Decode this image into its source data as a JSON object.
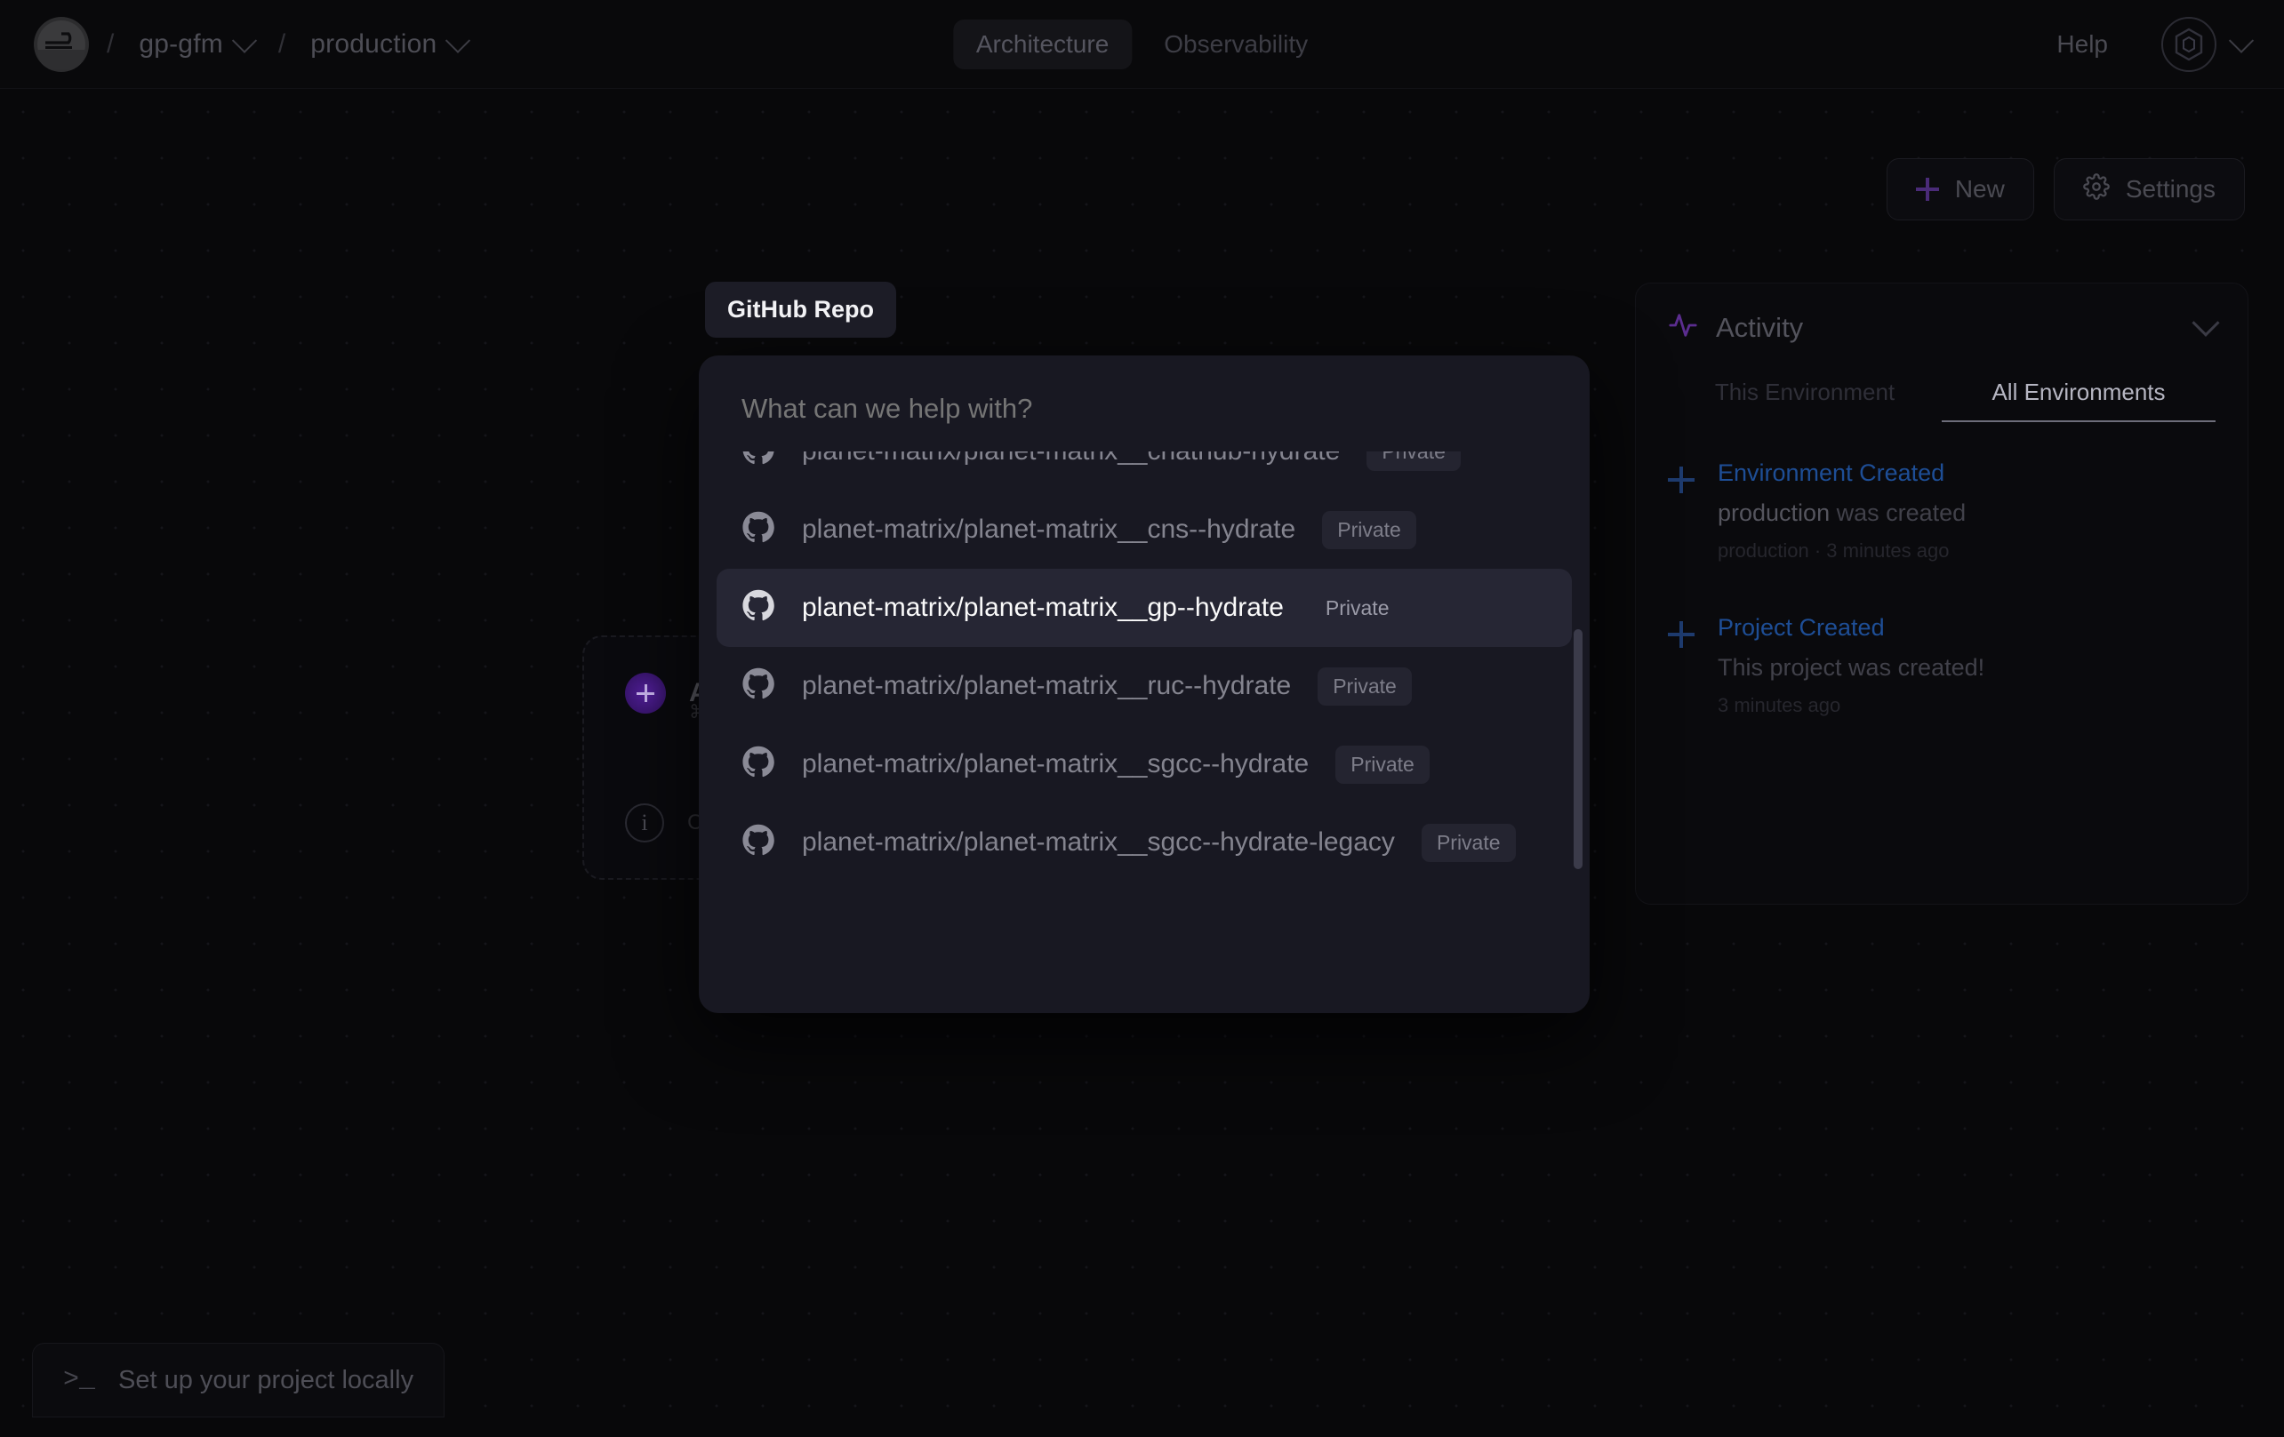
{
  "header": {
    "logo_icon": "platform-logo-icon",
    "breadcrumb": {
      "separator": "/",
      "project": "gp-gfm",
      "environment": "production"
    },
    "tabs": [
      {
        "label": "Architecture",
        "active": true
      },
      {
        "label": "Observability",
        "active": false
      }
    ],
    "help_label": "Help",
    "avatar_icon": "hexagon-avatar-icon",
    "avatar_chevron_icon": "chevron-down-icon"
  },
  "action_bar": {
    "new_label": "New",
    "new_icon": "plus-icon",
    "settings_label": "Settings",
    "settings_icon": "gear-icon"
  },
  "background_card": {
    "add_icon": "plus-circle-icon",
    "title": "A",
    "shortcut": "⌘",
    "info_icon": "info-icon",
    "note": "C"
  },
  "tooltip": {
    "label": "GitHub Repo"
  },
  "modal": {
    "search_placeholder": "What can we help with?",
    "search_value": "",
    "repo_icon": "github-icon",
    "badge_label": "Private",
    "repos": [
      {
        "name": "planet-matrix/planet-matrix__chathub-hydrate",
        "badge": "Private",
        "selected": false,
        "clipped": true
      },
      {
        "name": "planet-matrix/planet-matrix__cns--hydrate",
        "badge": "Private",
        "selected": false,
        "clipped": false
      },
      {
        "name": "planet-matrix/planet-matrix__gp--hydrate",
        "badge": "Private",
        "selected": true,
        "clipped": false
      },
      {
        "name": "planet-matrix/planet-matrix__ruc--hydrate",
        "badge": "Private",
        "selected": false,
        "clipped": false
      },
      {
        "name": "planet-matrix/planet-matrix__sgcc--hydrate",
        "badge": "Private",
        "selected": false,
        "clipped": false
      },
      {
        "name": "planet-matrix/planet-matrix__sgcc--hydrate-legacy",
        "badge": "Private",
        "selected": false,
        "clipped": false
      }
    ]
  },
  "activity": {
    "title": "Activity",
    "icon": "pulse-icon",
    "collapse_icon": "chevron-down-icon",
    "tabs": [
      {
        "label": "This Environment",
        "active": false
      },
      {
        "label": "All Environments",
        "active": true
      }
    ],
    "items": [
      {
        "icon": "plus-icon",
        "title": "Environment Created",
        "desc_subject": "production",
        "desc_rest": " was created",
        "meta": "production · 3 minutes ago"
      },
      {
        "icon": "plus-icon",
        "title": "Project Created",
        "desc_subject": "",
        "desc_rest": "This project was created!",
        "meta": "3 minutes ago"
      }
    ]
  },
  "setup_bar": {
    "icon": "terminal-icon",
    "icon_glyph": ">_",
    "label": "Set up your project locally"
  },
  "colors": {
    "background": "#08080a",
    "modal_background": "#181822",
    "selected_row": "#262634",
    "accent_purple": "#53209c",
    "accent_blue": "#1e4e96",
    "tooltip_background": "#1c1c26"
  }
}
